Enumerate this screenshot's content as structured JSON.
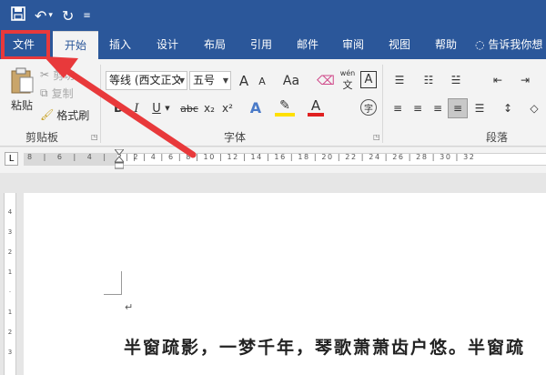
{
  "tabs": {
    "file": "文件",
    "home": "开始",
    "insert": "插入",
    "design": "设计",
    "layout": "布局",
    "references": "引用",
    "mailings": "邮件",
    "review": "审阅",
    "view": "视图",
    "help": "帮助",
    "tell_me": "告诉我你想"
  },
  "clipboard": {
    "paste": "粘贴",
    "cut": "剪切",
    "copy": "复制",
    "format_painter": "格式刷",
    "group_label": "剪贴板"
  },
  "font": {
    "font_name": "等线 (西文正文",
    "font_size": "五号",
    "group_label": "字体",
    "wen": "wén",
    "a_label": "A",
    "bold": "B",
    "italic": "I",
    "underline": "U",
    "strike": "abc",
    "subscript": "x₂",
    "superscript": "x²",
    "grow": "A",
    "shrink": "A",
    "aa": "Aa",
    "char": "字"
  },
  "paragraph": {
    "group_label": "段落"
  },
  "ruler": {
    "corner": "L",
    "left_ticks": "8 | 6 | 4 | 2 |",
    "right_ticks": "| 2 | 4 | 6 | 8 | 10 | 12 | 14 | 16 | 18 | 20 | 22 | 24 | 26 | 28 | 30 | 32"
  },
  "document": {
    "text": "半窗疏影，一梦千年，琴歌萧萧齿户悠。半窗疏",
    "para_mark": "↵"
  },
  "colors": {
    "brand_blue": "#2b579a",
    "highlight_red": "#e8393b"
  }
}
